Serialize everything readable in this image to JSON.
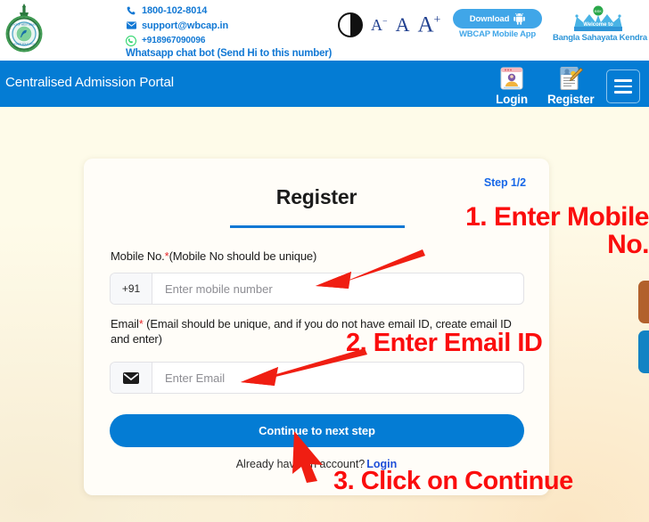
{
  "header": {
    "logo_icon": "west-bengal-government-emblem-icon",
    "contacts": [
      {
        "icon": "phone-icon",
        "text": "1800-102-8014"
      },
      {
        "icon": "envelope-icon",
        "text": "support@wbcap.in"
      },
      {
        "icon": "whatsapp-icon",
        "text": "+918967090096"
      }
    ],
    "whatsapp_note": "Whatsapp chat bot (Send Hi to this number)",
    "accessibility": {
      "contrast_label": "contrast-toggle-icon",
      "font_decrease": "A",
      "font_decrease_sup": "−",
      "font_normal": "A",
      "font_increase": "A",
      "font_increase_sup": "+"
    },
    "download": {
      "label": "Download",
      "icon": "android-robot-icon",
      "sub_label": "WBCAP Mobile App"
    },
    "bsk": {
      "welcome": "Welcome to",
      "title": "Bangla Sahayata Kendra",
      "icon": "crown-icon"
    }
  },
  "navbar": {
    "title": "Centralised Admission Portal",
    "items": [
      {
        "label": "Login",
        "icon": "login-window-icon"
      },
      {
        "label": "Register",
        "icon": "register-document-icon"
      }
    ],
    "menu_icon": "hamburger-menu-icon",
    "bg_color": "#047cd4"
  },
  "card": {
    "step": "Step 1/2",
    "title": "Register",
    "mobile": {
      "label_main": "Mobile No.",
      "label_req": "*",
      "label_hint": "(Mobile No should be unique)",
      "prefix": "+91",
      "placeholder": "Enter mobile number",
      "value": ""
    },
    "email": {
      "label_main": "Email",
      "label_req": "*",
      "label_hint": " (Email should be unique, and if you do not have email ID, create email ID and enter)",
      "prefix_icon": "envelope-icon",
      "placeholder": "Enter Email",
      "value": ""
    },
    "continue_label": "Continue to next step",
    "login_prompt": "Already have an account?",
    "login_link": "Login",
    "accent_color": "#047cd4",
    "link_color": "#1d4ed8"
  },
  "annotations": {
    "color": "#fb0d0d",
    "step1": "1. Enter Mobile\nNo.",
    "step2": "2. Enter Email ID",
    "step3": "3. Click on Continue",
    "arrow1": "arrow-pointing-to-mobile-input-icon",
    "arrow2": "arrow-pointing-to-email-input-icon",
    "arrow3": "cursor-arrow-pointing-to-continue-button-icon"
  },
  "side_tabs": [
    {
      "name": "feedback-tab",
      "color": "#b2612c"
    },
    {
      "name": "help-tab",
      "color": "#1283c4"
    }
  ]
}
